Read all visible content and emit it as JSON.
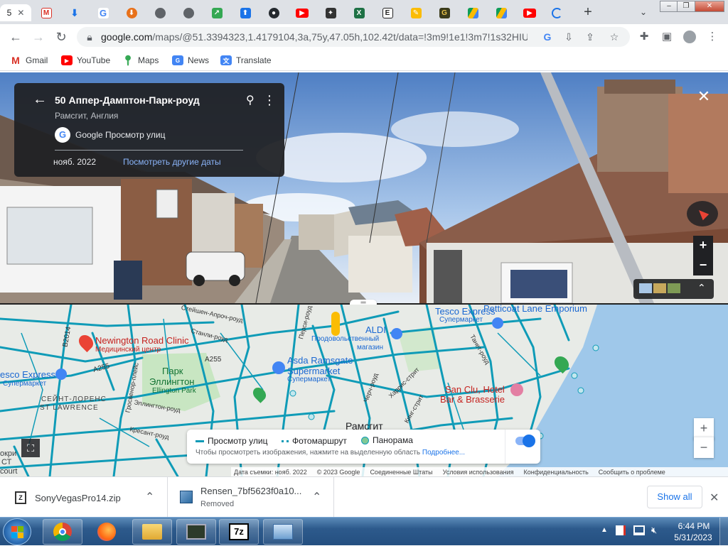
{
  "browser": {
    "active_tab_label": "5",
    "url_host": "google.com",
    "url_path": "/maps/@51.3394323,1.4179104,3a,75y,47.05h,102.42t/data=!3m9!1e1!3m7!1s32HIU...",
    "bookmarks": [
      {
        "label": "Gmail",
        "icon": "gmail-icon",
        "color": "#d93025"
      },
      {
        "label": "YouTube",
        "icon": "youtube-icon",
        "color": "#ff0000"
      },
      {
        "label": "Maps",
        "icon": "maps-icon",
        "color": "#34a853"
      },
      {
        "label": "News",
        "icon": "news-icon",
        "color": "#4285f4"
      },
      {
        "label": "Translate",
        "icon": "translate-icon",
        "color": "#4285f4"
      }
    ]
  },
  "streetview": {
    "title": "50 Аппер-Дамптон-Парк-роуд",
    "subtitle": "Рамсгит, Англия",
    "source": "Google Просмотр улиц",
    "date": "нояб. 2022",
    "other_dates": "Посмотреть другие даты"
  },
  "map": {
    "places": {
      "clinic": "Newington Road Clinic",
      "clinic_sub": "Медицинский центр",
      "tesco_left": "esco Express",
      "tesco_left_sub": "Супермаркет",
      "park": "Парк",
      "park2": "Эллингтон",
      "park_en": "Ellington Park",
      "stlaw": "СЕЙНТ-ЛОРЕНС",
      "stlaw_en": "ST LAWRENCE",
      "asda": "Asda Ramsgate",
      "asda2": "Supermarket",
      "asda_sub": "Супермаркет",
      "aldi": "ALDI",
      "aldi_sub": "Продовольственный",
      "aldi_sub2": "магазин",
      "tesco_top": "Tesco Express",
      "tesco_top_sub": "Супермаркет",
      "petticoat": "Petticoat Lane Emporium",
      "sanclu": "San Clu, Hotel",
      "sanclu2": "Bar & Brasserie",
      "ramsgate": "Рамсгит",
      "a255a": "A255",
      "a255b": "A255",
      "b2014": "B2014",
      "st1": "Стейшен-Апроч-роуд",
      "st2": "Станли-роуд",
      "st3": "Эллингтон-роуд",
      "st4": "Кресант-роуд",
      "st5": "Черч-роуд",
      "st6": "Харрис-стрит",
      "st7": "Танет-роуд",
      "st8": "Кинг-стрит",
      "st9": "Перси-роуд",
      "st10": "Гросвенор-плейс"
    },
    "layers": {
      "streetview": "Просмотр улиц",
      "photoroute": "Фотомаршрут",
      "panorama": "Панорама",
      "hint": "Чтобы просмотреть изображения, нажмите на выделенную область",
      "more": "Подробнее..."
    },
    "attribution": [
      "Дата съемки: нояб. 2022",
      "© 2023 Google",
      "Соединенные Штаты",
      "Условия использования",
      "Конфиденциальность",
      "Сообщить о проблеме"
    ],
    "left_edge": [
      "окри",
      "СТ",
      "court"
    ]
  },
  "downloads": {
    "items": [
      {
        "name": "SonyVegasPro14.zip",
        "status": ""
      },
      {
        "name": "Rensen_7bf5623f0a10...",
        "status": "Removed"
      }
    ],
    "show_all": "Show all"
  },
  "taskbar": {
    "time": "6:44 PM",
    "date": "5/31/2023"
  },
  "colors": {
    "street_line": "#0f9bb7",
    "card_bg": "#202124",
    "link_blue": "#8ab4f8",
    "poi_red": "#ea4335",
    "poi_blue": "#4285f4",
    "poi_green": "#34a853",
    "sea": "#9fc8ea"
  }
}
